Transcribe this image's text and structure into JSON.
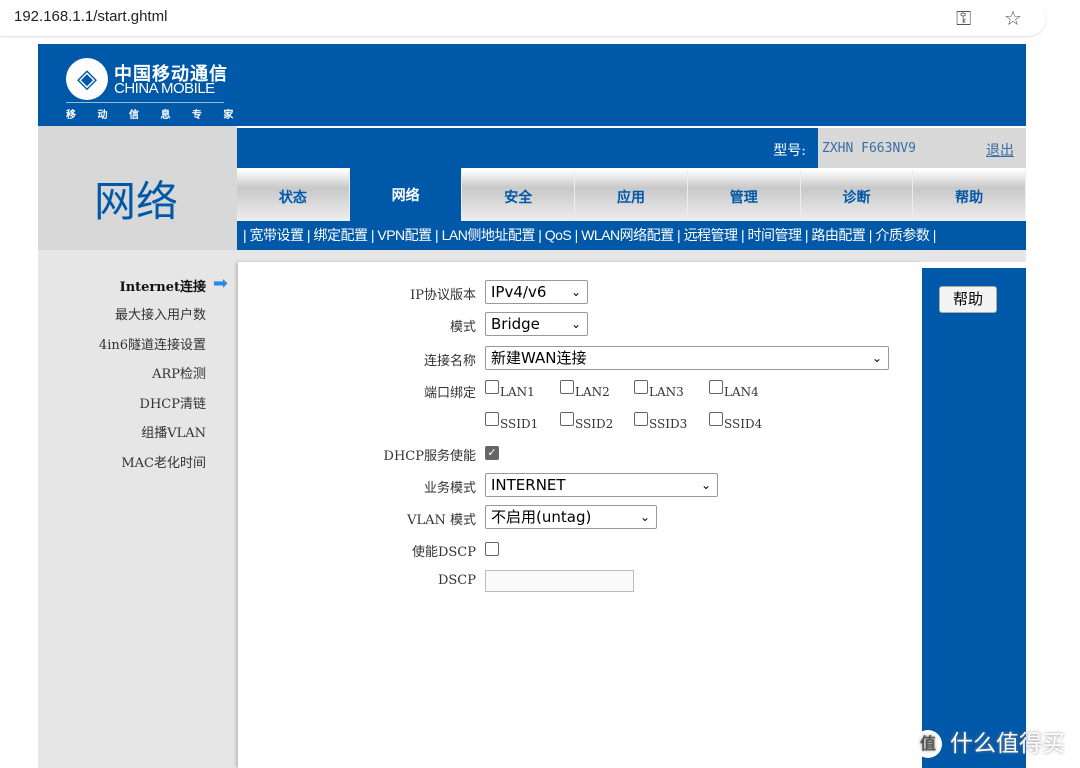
{
  "browser": {
    "url": "192.168.1.1/start.ghtml",
    "icons": [
      "key-icon",
      "star-icon"
    ]
  },
  "logo": {
    "cn": "中国移动通信",
    "en": "CHINA MOBILE",
    "sub": "移 动 信 息 专 家"
  },
  "section_title": "网络",
  "model_label": "型号:",
  "model": "ZXHN F663NV9",
  "logout": "退出",
  "tabs": [
    {
      "label": "状态"
    },
    {
      "label": "网络",
      "active": true
    },
    {
      "label": "安全"
    },
    {
      "label": "应用"
    },
    {
      "label": "管理"
    },
    {
      "label": "诊断"
    },
    {
      "label": "帮助"
    }
  ],
  "submenu": [
    "宽带设置",
    "绑定配置",
    "VPN配置",
    "LAN侧地址配置",
    "QoS",
    "WLAN网络配置",
    "远程管理",
    "时间管理",
    "路由配置",
    "介质参数"
  ],
  "sidebar": [
    {
      "label": "Internet连接",
      "active": true
    },
    {
      "label": "最大接入用户数"
    },
    {
      "label": "4in6隧道连接设置"
    },
    {
      "label": "ARP检测"
    },
    {
      "label": "DHCP清链"
    },
    {
      "label": "组播VLAN"
    },
    {
      "label": "MAC老化时间"
    }
  ],
  "form": {
    "ip_version": {
      "label": "IP协议版本",
      "value": "IPv4/v6"
    },
    "mode": {
      "label": "模式",
      "value": "Bridge"
    },
    "conn_name": {
      "label": "连接名称",
      "value": "新建WAN连接"
    },
    "port_binding": {
      "label": "端口绑定",
      "ports": [
        {
          "name": "LAN1",
          "checked": false
        },
        {
          "name": "LAN2",
          "checked": false
        },
        {
          "name": "LAN3",
          "checked": false
        },
        {
          "name": "LAN4",
          "checked": false
        },
        {
          "name": "SSID1",
          "checked": false
        },
        {
          "name": "SSID2",
          "checked": false
        },
        {
          "name": "SSID3",
          "checked": false
        },
        {
          "name": "SSID4",
          "checked": false
        }
      ]
    },
    "dhcp": {
      "label": "DHCP服务使能",
      "checked": true
    },
    "service_mode": {
      "label": "业务模式",
      "value": "INTERNET"
    },
    "vlan_mode": {
      "label": "VLAN 模式",
      "value": "不启用(untag)"
    },
    "enable_dscp": {
      "label": "使能DSCP",
      "checked": false
    },
    "dscp": {
      "label": "DSCP",
      "value": ""
    }
  },
  "help_button": "帮助",
  "watermark": {
    "badge": "值",
    "text": "什么值得买"
  }
}
